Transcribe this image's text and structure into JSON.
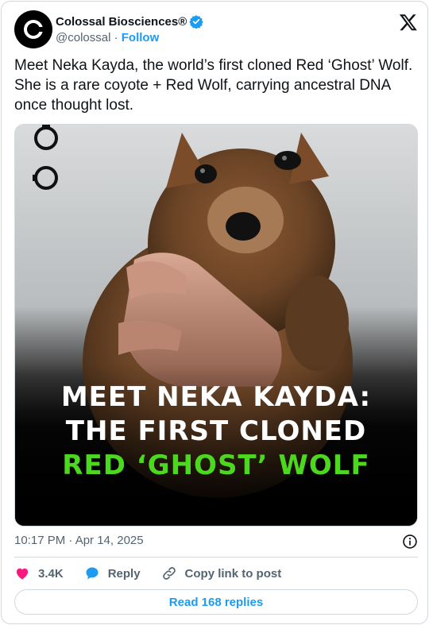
{
  "author": {
    "name": "Colossal Biosciences®",
    "handle": "@colossal",
    "separator": "·",
    "follow_label": "Follow",
    "verified": true
  },
  "tweet": {
    "text": "Meet Neka Kayda, the world’s first cloned Red ‘Ghost’ Wolf. She is a rare coyote + Red Wolf, carrying ancestral DNA once thought lost."
  },
  "media": {
    "overlay_line1": "MEET NEKA KAYDA:",
    "overlay_line2": "THE FIRST CLONED",
    "overlay_line3": "RED ‘GHOST’ WOLF",
    "accent_color": "#4cd81f"
  },
  "meta": {
    "timestamp": "10:17 PM · Apr 14, 2025"
  },
  "actions": {
    "like_count": "3.4K",
    "reply_label": "Reply",
    "copy_label": "Copy link to post"
  },
  "footer": {
    "read_replies_label": "Read 168 replies"
  },
  "colors": {
    "brand_blue": "#1d9bf0",
    "like_pink": "#f91880",
    "text_primary": "#0f1419",
    "text_secondary": "#536471"
  },
  "icons": [
    "colossal-logo-icon",
    "verified-badge-icon",
    "x-logo-icon",
    "info-icon",
    "heart-icon",
    "reply-bubble-icon",
    "link-icon"
  ]
}
